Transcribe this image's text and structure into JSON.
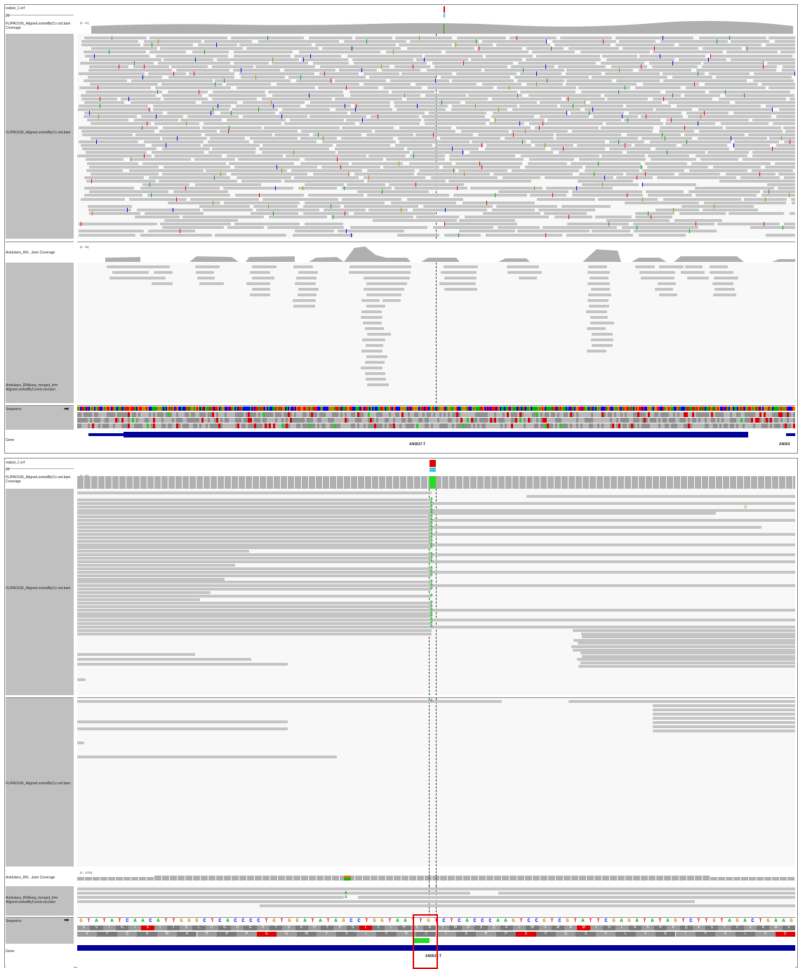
{
  "top_view": {
    "vcf_track": "output_1.vcf",
    "vcf_index": "20",
    "coverage_track_1": "FLIPAO166_Aligned.sortedByCo ord.bam Coverage",
    "coverage_scale_1": "[0 - 22]",
    "alignment_track_1": "FLIPAO166_Aligned.sortedByCo ord.bam",
    "coverage_track_2": "Anidulans_RN....bam Coverage",
    "coverage_scale_2": "[0 - 16]",
    "alignment_track_2": "Anidulans_RNAseq_merged_trim Aligned.sortedByCoord.out.bam",
    "sequence_label": "Sequence",
    "sequence_arrow": "➡",
    "gene_label": "Gene",
    "gene_name": "AN0637-T",
    "gene_name_right": "AN063"
  },
  "bottom_view": {
    "vcf_track": "output_1.vcf",
    "vcf_index": "20",
    "coverage_track_1": "FLIPAO166_Aligned.sortedByCo ord.bam Coverage",
    "coverage_scale_1": "[0 - 30]",
    "alignment_track_1": "FLIPAO166_Aligned.sortedByCo ord.bam",
    "alignment_track_1b": "FLIPAO166_Aligned.sortedByCo ord.bam",
    "coverage_track_2": "Anidulans_RN....bam Coverage",
    "coverage_scale_2": "[0 - 1030]",
    "alignment_track_2": "Anidulans_RNAseq_merged_trim Aligned.sortedByCoord.out.bam",
    "sequence_label": "Sequence",
    "sequence_arrow": "➡",
    "gene_label": "Gene",
    "gene_name": "AN0637-T",
    "mismatch_base": "A",
    "stray_base_c": "C",
    "stray_base_g": "G",
    "dna_sequence": "GTATATCAACATTGGGCTCACCCCTGTGGATATAGCCTGGTAATTGTCTCACCCAAGTCCGTCGTATTCGAGATATAGTCTTGTAGACTGAAG",
    "frame1": "SVINISLTSLCGSGKTSKHTPSLCLHSRTWDSQFLWVWRMLNLNSPKQKSTCSRMS",
    "frame2": "VYQHWAHPPGGWYSLVNCLSHPSPQSVLFEIYSLVD"
  },
  "colors": {
    "A": "#00b000",
    "C": "#0000ff",
    "G": "#d08000",
    "T": "#ff0000",
    "read": "#c4c4c4",
    "coverage": "#b0b0b0",
    "gene": "#00009b",
    "highlight": "#e00000"
  }
}
